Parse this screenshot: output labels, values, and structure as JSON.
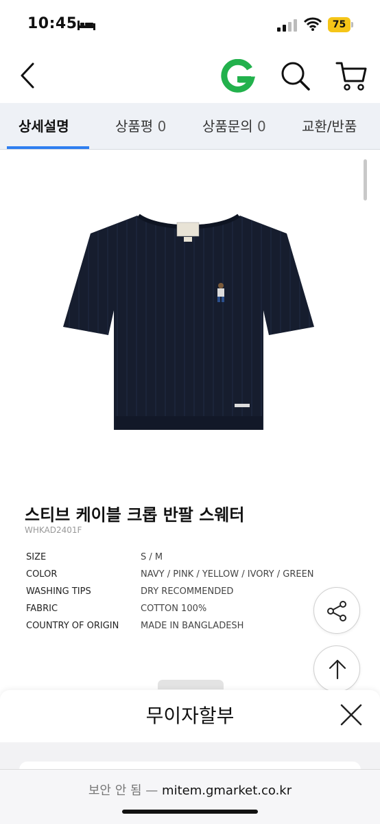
{
  "status_bar": {
    "time": "10:45",
    "battery_level": "75",
    "icons": [
      "bed-icon",
      "signal-icon",
      "wifi-icon",
      "battery-icon"
    ]
  },
  "nav": {
    "icons": [
      "back-icon",
      "gmarket-g-logo",
      "search-icon",
      "cart-icon"
    ],
    "brand_color": "#22b14c"
  },
  "tabs": [
    {
      "label": "상세설명",
      "count": ""
    },
    {
      "label": "상품평",
      "count": "0"
    },
    {
      "label": "상품문의",
      "count": "0"
    },
    {
      "label": "교환/반품",
      "count": ""
    }
  ],
  "active_tab_color": "#2f7ff0",
  "product": {
    "title": "스티브 케이블 크롭 반팔 스웨터",
    "code": "WHKAD2401F",
    "garment_color": "#161d2e",
    "specs": [
      {
        "label": "SIZE",
        "value": "S / M"
      },
      {
        "label": "COLOR",
        "value": "NAVY / PINK / YELLOW / IVORY / GREEN"
      },
      {
        "label": "WASHING TIPS",
        "value": "DRY RECOMMENDED"
      },
      {
        "label": "FABRIC",
        "value": "COTTON 100%"
      },
      {
        "label": "COUNTRY OF ORIGIN",
        "value": "MADE IN BANGLADESH"
      }
    ]
  },
  "fabs": [
    "share-icon",
    "arrow-up-icon"
  ],
  "sheet": {
    "title": "무이자할부",
    "close_icon": "close-icon"
  },
  "address_bar": {
    "insecure_label": "보안 안 됨",
    "separator": "—",
    "domain": "mitem.gmarket.co.kr"
  }
}
